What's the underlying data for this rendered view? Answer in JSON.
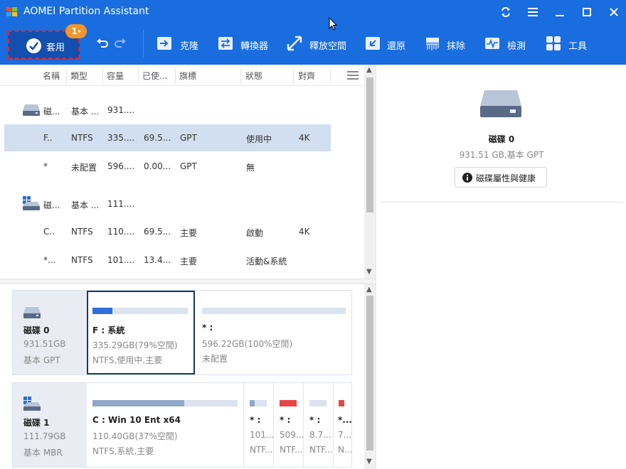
{
  "titlebar": {
    "title": "AOMEI Partition Assistant",
    "accent": "#1a6dde"
  },
  "toolbar": {
    "apply_label": "套用",
    "apply_badge": "1",
    "items": [
      {
        "label": "克隆",
        "icon": "clone-icon"
      },
      {
        "label": "轉換器",
        "icon": "convert-icon"
      },
      {
        "label": "釋放空間",
        "icon": "free-space-icon"
      },
      {
        "label": "還原",
        "icon": "restore-icon"
      },
      {
        "label": "抹除",
        "icon": "wipe-icon"
      },
      {
        "label": "檢測",
        "icon": "test-icon"
      },
      {
        "label": "工具",
        "icon": "tools-icon"
      }
    ]
  },
  "table": {
    "columns": [
      "名稱",
      "類型",
      "容量",
      "已使...",
      "旗標",
      "狀態",
      "對齊"
    ],
    "rows": [
      {
        "kind": "disk",
        "icon": "hdd-icon",
        "name": "磁...",
        "type": "基本 ...",
        "size": "931....",
        "used": "",
        "flag": "",
        "status": "",
        "align": ""
      },
      {
        "kind": "part",
        "selected": true,
        "name": "F..",
        "type": "NTFS",
        "size": "335....",
        "used": "69.5...",
        "flag": "GPT",
        "status": "使用中",
        "align": "4K"
      },
      {
        "kind": "part",
        "name": "*",
        "type": "未配置",
        "size": "596....",
        "used": "0.00...",
        "flag": "GPT",
        "status": "無",
        "align": ""
      },
      {
        "kind": "disk",
        "icon": "windows-disk-icon",
        "name": "磁...",
        "type": "基本 ...",
        "size": "111....",
        "used": "",
        "flag": "",
        "status": "",
        "align": ""
      },
      {
        "kind": "part",
        "name": "C..",
        "type": "NTFS",
        "size": "110....",
        "used": "69.5...",
        "flag": "主要",
        "status": "啟動",
        "align": "4K"
      },
      {
        "kind": "part",
        "name": "*...",
        "type": "NTFS",
        "size": "101....",
        "used": "13.4...",
        "flag": "主要",
        "status": "活動&系統",
        "align": ""
      }
    ]
  },
  "disk_map": {
    "disk0": {
      "name": "磁碟 0",
      "size": "931.51GB",
      "type": "基本 GPT",
      "partitions": [
        {
          "title": "F : 系統",
          "line1": "335.29GB(79%空閒)",
          "line2": "NTFS,使用中,主要",
          "used_fraction": 0.21,
          "color": "#2f6fdc"
        },
        {
          "title": "* :",
          "line1": "596.22GB(100%空閒)",
          "line2": "未配置",
          "used_fraction": 0.0,
          "color": "#dbe3ef"
        }
      ]
    },
    "disk1": {
      "name": "磁碟 1",
      "size": "111.79GB",
      "type": "基本 MBR",
      "partitions": [
        {
          "title": "C : Win 10 Ent x64",
          "line1": "110.40GB(37%空閒)",
          "line2": "NTFS,系統,主要",
          "used_fraction": 0.63,
          "color": "#8fa8c8"
        },
        {
          "title": "* :",
          "line1": "101...",
          "line2": "NTF...",
          "used_fraction": 0.3,
          "color": "#8fa8c8"
        },
        {
          "title": "* :",
          "line1": "509...",
          "line2": "NTF...",
          "used_fraction": 1.0,
          "color": "#e84545"
        },
        {
          "title": "* :",
          "line1": "8.7...",
          "line2": "NTF...",
          "used_fraction": 0.0,
          "color": "#dbe3ef"
        },
        {
          "title": "*...",
          "line1": "7....",
          "line2": "N...",
          "used_fraction": 1.0,
          "color": "#e84545"
        }
      ]
    }
  },
  "details": {
    "disk_title": "磁碟 0",
    "disk_sub": "931.51 GB,基本 GPT",
    "props_button": "磁碟屬性與健康"
  }
}
